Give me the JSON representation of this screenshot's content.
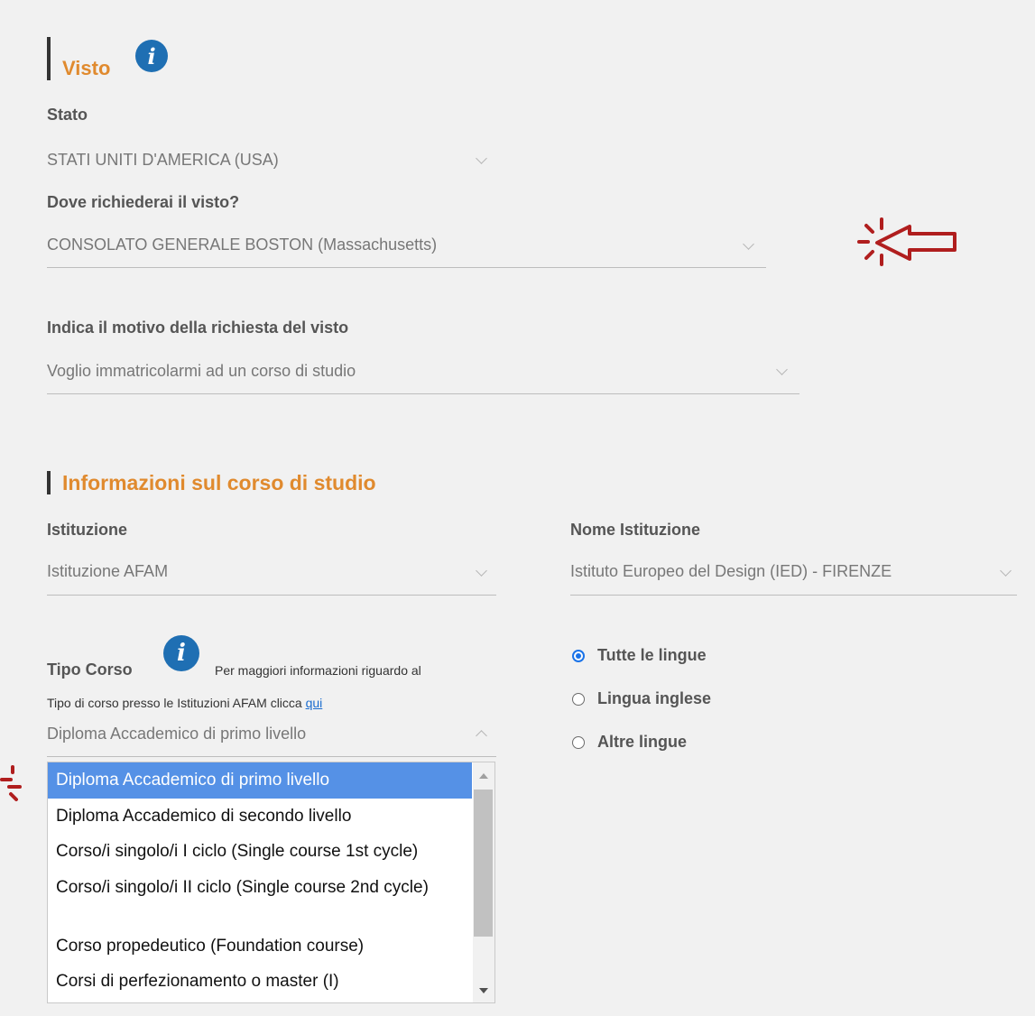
{
  "visto": {
    "title": "Visto",
    "stato_label": "Stato",
    "stato_value": "STATI UNITI D'AMERICA (USA)",
    "dove_label": "Dove richiederai il visto?",
    "dove_value": "CONSOLATO GENERALE BOSTON (Massachusetts)",
    "motivo_label": "Indica il motivo della richiesta del visto",
    "motivo_value": "Voglio immatricolarmi ad un corso di studio"
  },
  "corso": {
    "title": "Informazioni sul corso di studio",
    "istituzione_label": "Istituzione",
    "istituzione_value": "Istituzione AFAM",
    "nome_label": "Nome Istituzione",
    "nome_value": "Istituto Europeo del Design (IED) - FIRENZE",
    "tipo_label": "Tipo Corso",
    "tipo_info_1": "Per maggiori informazioni riguardo al",
    "tipo_info_2": "Tipo di corso presso le Istituzioni AFAM clicca",
    "tipo_info_link": "qui",
    "tipo_value": "Diploma Accademico di primo livello"
  },
  "lingue": {
    "options": [
      "Tutte le lingue",
      "Lingua inglese",
      "Altre lingue"
    ],
    "selected_index": 0
  },
  "dropdown": {
    "items": [
      "Diploma Accademico di primo livello",
      "Diploma Accademico di secondo livello",
      "Corso/i singolo/i I ciclo (Single course 1st cycle)",
      "Corso/i singolo/i II ciclo (Single course 2nd cycle)",
      "Corso propedeutico (Foundation course)",
      "Corsi di perfezionamento o master (I)"
    ],
    "selected_index": 0
  },
  "icons": {
    "info": "info-icon",
    "pointer_annotation": "hand-pointer-annotation-icon"
  },
  "colors": {
    "accent_orange": "#e08a2e",
    "info_blue": "#1f6fb3",
    "selected_item": "#5591e6",
    "annotation_red": "#b01e1e"
  }
}
